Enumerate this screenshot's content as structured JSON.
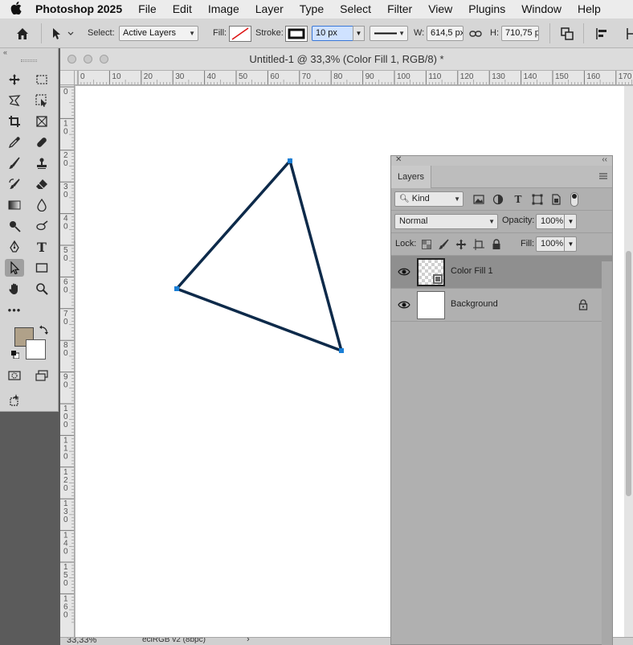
{
  "menubar": {
    "app_name": "Photoshop 2025",
    "items": [
      "File",
      "Edit",
      "Image",
      "Layer",
      "Type",
      "Select",
      "Filter",
      "View",
      "Plugins",
      "Window",
      "Help"
    ]
  },
  "options_bar": {
    "select_label": "Select:",
    "select_value": "Active Layers",
    "fill_label": "Fill:",
    "stroke_label": "Stroke:",
    "stroke_width": "10 px",
    "w_label": "W:",
    "w_value": "614,5 px",
    "h_label": "H:",
    "h_value": "710,75 p"
  },
  "toolbox": {
    "foreground_color": "#b0a189",
    "background_color": "#ffffff",
    "icons": [
      "move-icon",
      "marquee-icon",
      "lasso-icon",
      "object-select-icon",
      "crop-icon",
      "frame-icon",
      "eyedropper-icon",
      "healing-icon",
      "brush-icon",
      "stamp-icon",
      "history-brush-icon",
      "eraser-icon",
      "gradient-icon",
      "blur-icon",
      "dodge-icon",
      "smudge-icon",
      "pen-icon",
      "type-icon",
      "path-select-icon",
      "rectangle-icon",
      "hand-icon",
      "zoom-icon",
      "more-icon"
    ]
  },
  "document": {
    "title": "Untitled-1 @ 33,3% (Color Fill 1, RGB/8) *",
    "zoom": "33,33%",
    "color_profile": "eciRGB v2 (8bpc)",
    "ruler_h_labels": [
      "0",
      "10",
      "20",
      "30",
      "40",
      "50",
      "60",
      "70",
      "80",
      "90",
      "100",
      "110",
      "120",
      "130",
      "140",
      "150",
      "160",
      "170"
    ],
    "ruler_v_labels": [
      "0",
      "1 0",
      "2 0",
      "3 0",
      "4 0",
      "5 0",
      "6 0",
      "7 0",
      "8 0",
      "9 0",
      "1 0 0",
      "1 1 0",
      "1 2 0",
      "1 3 0",
      "1 4 0",
      "1 5 0",
      "1 6 0"
    ],
    "stroke_color": "#0d2a4a",
    "anchor_color": "#1a7fd6"
  },
  "layers_panel": {
    "tab_label": "Layers",
    "filter_kind": "Kind",
    "blend_mode": "Normal",
    "opacity_label": "Opacity:",
    "opacity_value": "100%",
    "lock_label": "Lock:",
    "fill_label": "Fill:",
    "fill_value": "100%",
    "layers": [
      {
        "name": "Color Fill 1",
        "selected": true
      },
      {
        "name": "Background",
        "locked": true
      }
    ]
  }
}
